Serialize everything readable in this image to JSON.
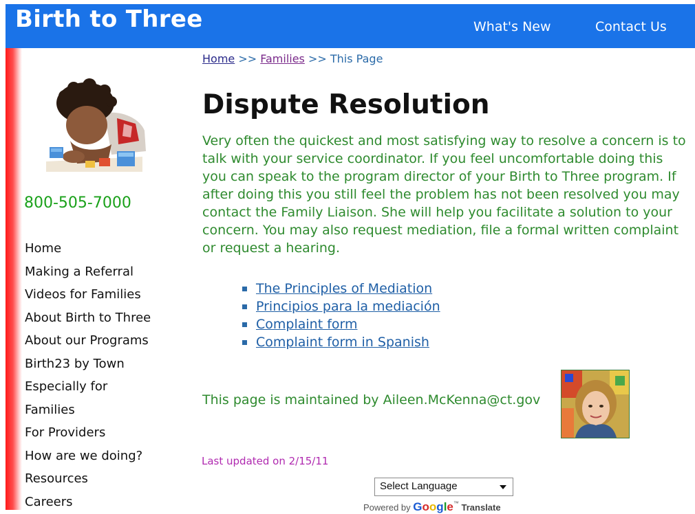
{
  "header": {
    "site_title": "Birth to Three",
    "links": [
      {
        "label": "What's New"
      },
      {
        "label": "Contact Us"
      }
    ],
    "bg_color": "#1a73e8"
  },
  "sidebar": {
    "phone": "800-505-7000",
    "nav": [
      "Home",
      "Making a Referral",
      "Videos for Families",
      "About Birth to Three",
      "About our Programs",
      "Birth23 by Town",
      "Especially for",
      "Families",
      "For Providers",
      "How are we doing?",
      "Resources",
      "Careers"
    ]
  },
  "breadcrumb": {
    "home": "Home",
    "sep1": ">>",
    "families": "Families",
    "sep2": ">>",
    "current": "This Page"
  },
  "main": {
    "title": "Dispute Resolution",
    "intro": "Very often the quickest and most satisfying way to resolve a concern is to talk with your service coordinator. If you feel uncomfortable doing this you can speak to the program director of your Birth to Three program. If after doing this you still feel the problem has not been resolved you may contact the Family Liaison. She will help you facilitate a solution to your concern. You may also request mediation, file a formal written complaint or request a hearing.",
    "links": [
      "The Principles of Mediation",
      "Principios para la mediación",
      "Complaint form",
      "Complaint form in Spanish"
    ],
    "maintainer": "This page is maintained by Aileen.McKenna@ct.gov",
    "updated": "Last updated on 2/15/11"
  },
  "translate": {
    "select_label": "Select Language",
    "powered_by": "Powered by",
    "google": "Google",
    "tm": "™",
    "translate": "Translate"
  },
  "colors": {
    "green_text": "#2e8a2e",
    "link_blue": "#1f5fa6",
    "updated_magenta": "#b02ab0",
    "phone_green": "#1aa11a"
  }
}
